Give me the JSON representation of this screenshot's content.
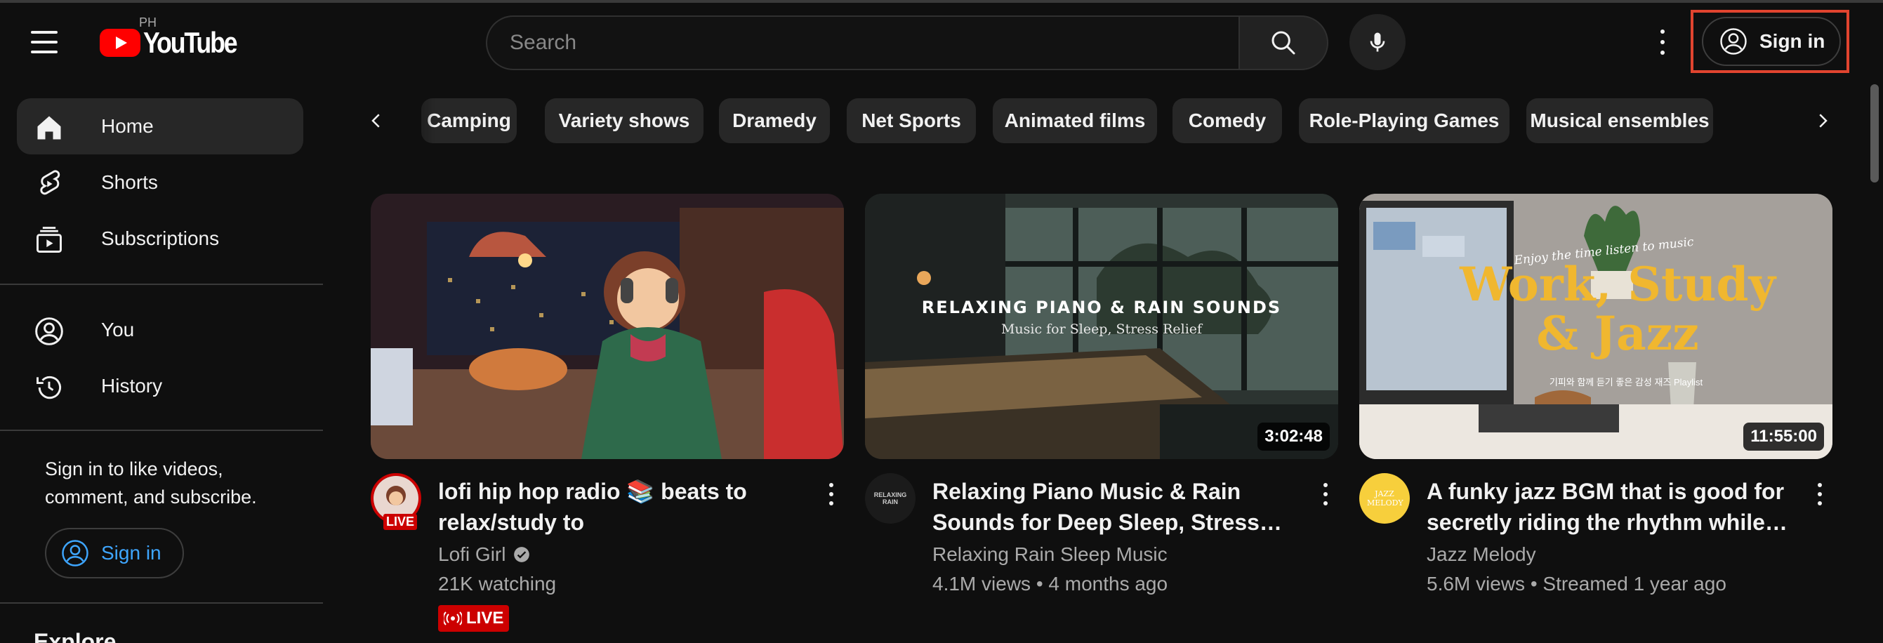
{
  "header": {
    "logo_text": "YouTube",
    "region": "PH",
    "search_placeholder": "Search",
    "sign_in_label": "Sign in"
  },
  "sidebar": {
    "items": [
      {
        "label": "Home",
        "icon": "home-icon",
        "active": true
      },
      {
        "label": "Shorts",
        "icon": "shorts-icon"
      },
      {
        "label": "Subscriptions",
        "icon": "subscriptions-icon"
      },
      {
        "label": "You",
        "icon": "you-icon"
      },
      {
        "label": "History",
        "icon": "history-icon"
      }
    ],
    "sign_in_prompt": "Sign in to like videos, comment, and subscribe.",
    "sign_in_label": "Sign in",
    "explore_label": "Explore"
  },
  "chips": [
    "Camping",
    "Variety shows",
    "Dramedy",
    "Net Sports",
    "Animated films",
    "Comedy",
    "Role-Playing Games",
    "Musical ensembles"
  ],
  "videos": [
    {
      "title": "lofi hip hop radio 📚 beats to relax/study to",
      "channel": "Lofi Girl",
      "verified": true,
      "meta": "21K watching",
      "live_label": "LIVE",
      "avatar_badge": "LIVE",
      "duration": ""
    },
    {
      "title": "Relaxing Piano Music & Rain Sounds for Deep Sleep, Stress Relief and…",
      "channel": "Relaxing Rain Sleep Music",
      "meta": "4.1M views • 4 months ago",
      "duration": "3:02:48",
      "thumb_heading": "RELAXING PIANO & RAIN SOUNDS",
      "thumb_sub": "Music for Sleep, Stress Relief",
      "avatar_text": "RELAXING RAIN"
    },
    {
      "title": "A funky jazz BGM that is good for secretly riding the rhythm while…",
      "channel": "Jazz Melody",
      "meta": "5.6M views • Streamed 1 year ago",
      "duration": "11:55:00",
      "thumb_tag": "Enjoy the time listen to music",
      "thumb_line1": "Work, Study",
      "thumb_line2": "& Jazz",
      "thumb_korean": "기피와 함께 듣기 좋은 감성 재즈 Playlist",
      "avatar_text": "JAZZ MELODY"
    }
  ],
  "colors": {
    "background": "#0f0f0f",
    "chip": "#272727",
    "accent_blue": "#3ea6ff",
    "live_red": "#cc0000",
    "highlight": "#e1442f"
  }
}
